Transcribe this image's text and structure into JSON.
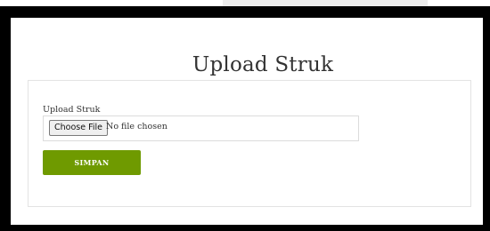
{
  "page": {
    "title": "Upload Struk"
  },
  "form": {
    "field_label": "Upload Struk",
    "file_input": {
      "button_label": "Choose File",
      "status_text": "No file chosen"
    },
    "submit_label": "SIMPAN"
  },
  "colors": {
    "frame": "#000000",
    "accent": "#6f9a00",
    "panel_border": "#e3e3e3"
  }
}
